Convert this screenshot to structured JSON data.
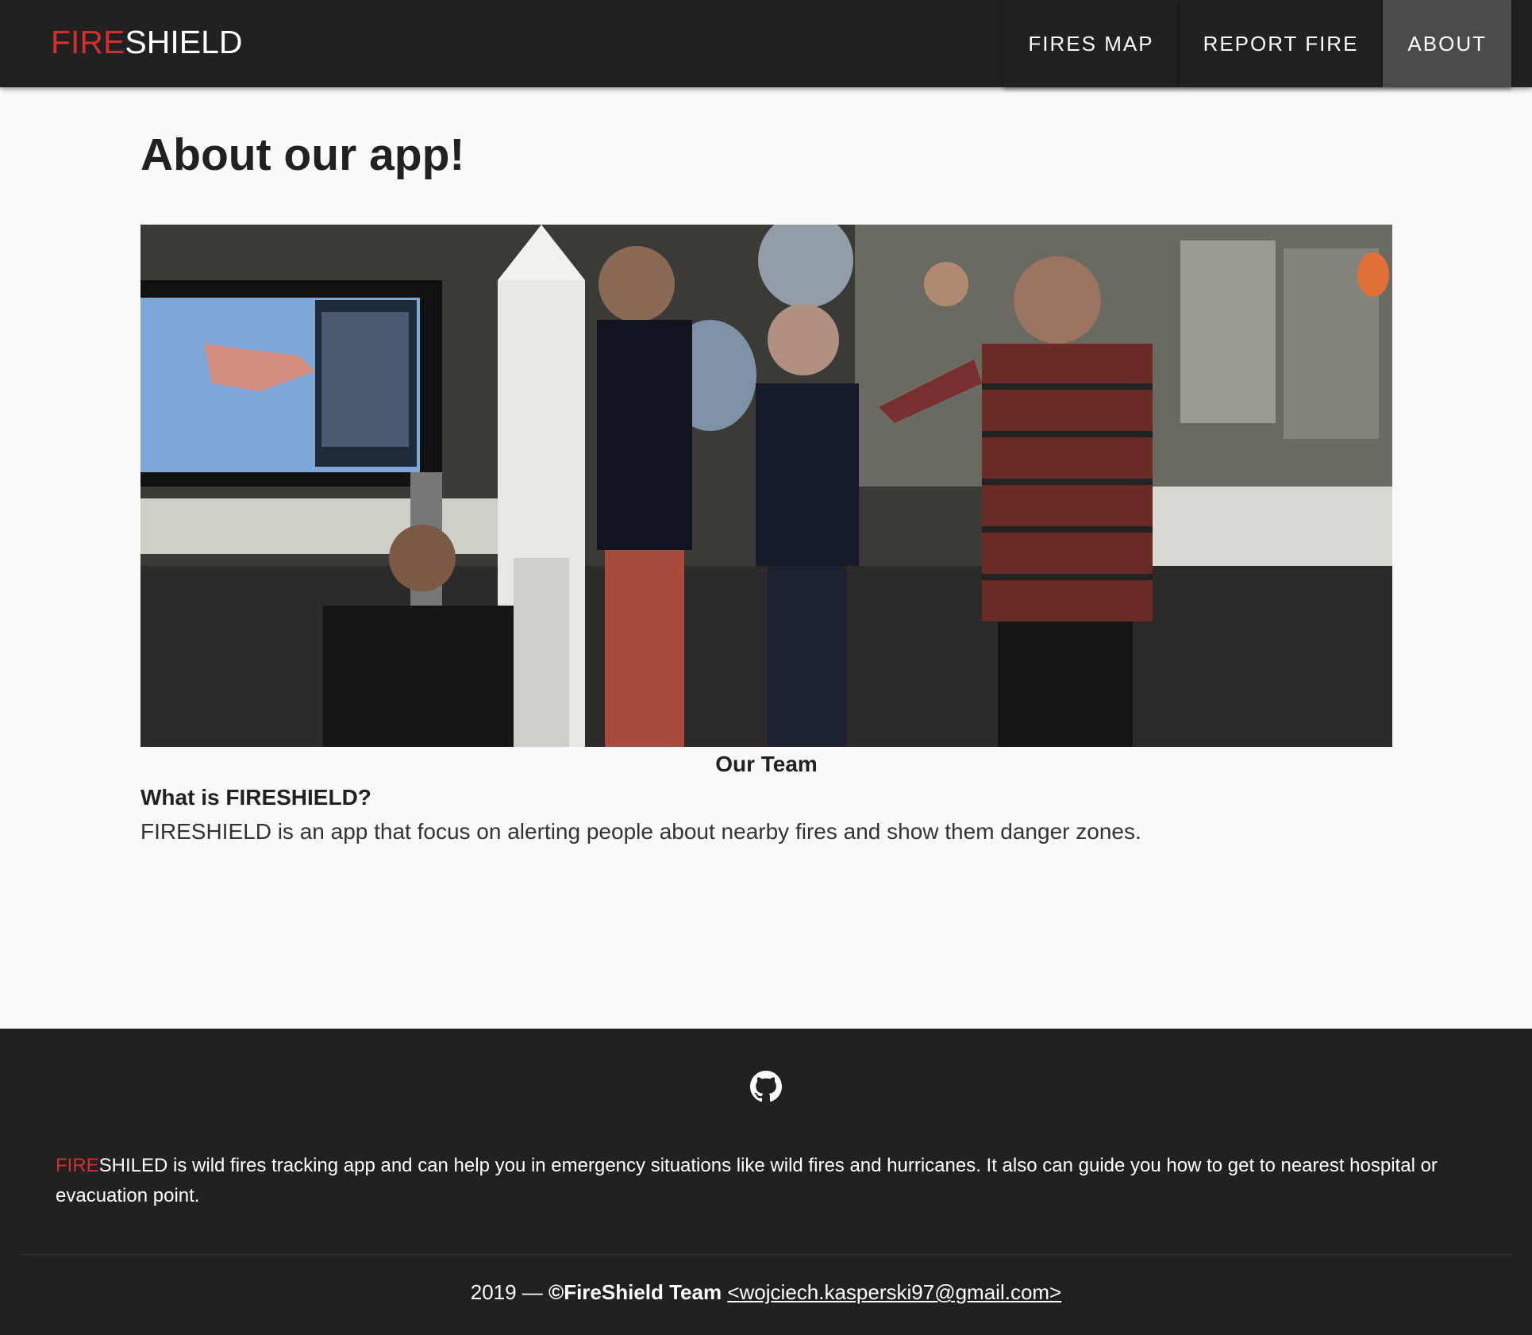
{
  "header": {
    "brand_red": "FIRE",
    "brand_white": "SHIELD",
    "nav": [
      {
        "label": "FIRES MAP"
      },
      {
        "label": "REPORT FIRE"
      },
      {
        "label": "ABOUT"
      }
    ]
  },
  "main": {
    "title": "About our app!",
    "photo_caption": "Our Team",
    "question_prefix": "What is ",
    "question_brand": "FIRESHIELD?",
    "description": "FIRESHIELD is an app that focus on alerting people about nearby fires and show them danger zones."
  },
  "footer": {
    "icon": "github-icon",
    "brand_red": "FIRE",
    "brand_white": "SHILED",
    "text": " is wild fires tracking app and can help you in emergency situations like wild fires and hurricanes. It also can guide you how to get to nearest hospital or evacuation point.",
    "year": "2019 — ",
    "team": "©FireShield Team",
    "email": "<wojciech.kasperski97@gmail.com>"
  },
  "colors": {
    "accent_red": "#d32f2f",
    "dark": "#212121",
    "active_nav": "#4a4a4a",
    "background": "#fafafa"
  }
}
